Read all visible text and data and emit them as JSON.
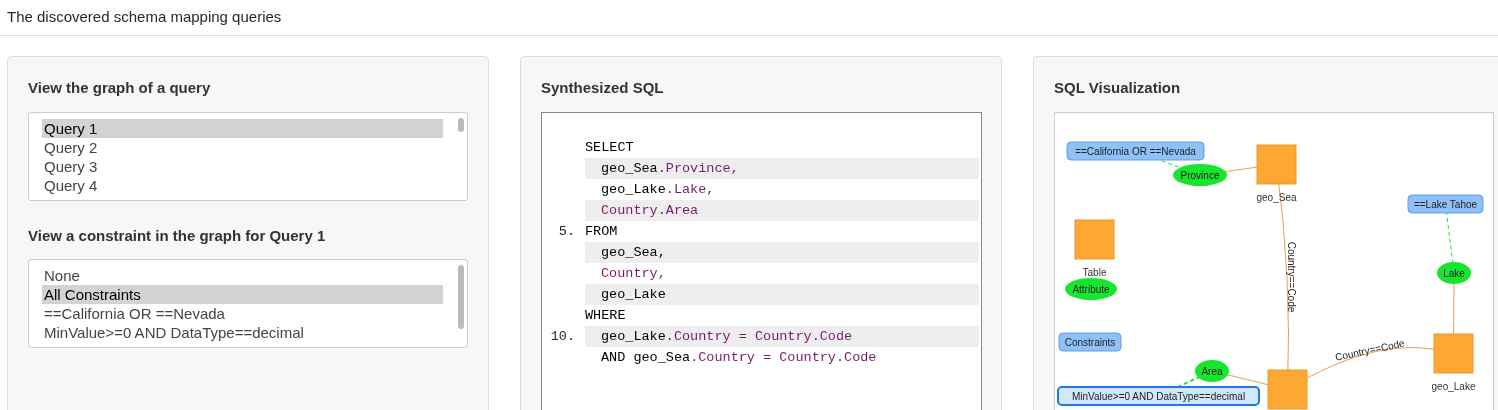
{
  "header": {
    "title": "The discovered schema mapping queries"
  },
  "query_panel": {
    "title": "View the graph of a query",
    "queries": [
      {
        "label": "Query 1",
        "selected": true
      },
      {
        "label": "Query 2",
        "selected": false
      },
      {
        "label": "Query 3",
        "selected": false
      },
      {
        "label": "Query 4",
        "selected": false
      }
    ],
    "constraint_title": "View a constraint in the graph for Query 1",
    "constraints": [
      {
        "label": "None",
        "selected": false
      },
      {
        "label": "All Constraints",
        "selected": true
      },
      {
        "label": "==California OR ==Nevada",
        "selected": false
      },
      {
        "label": "MinValue>=0 AND DataType==decimal",
        "selected": false
      }
    ]
  },
  "sql_panel": {
    "title": "Synthesized SQL",
    "clauses": [
      {
        "keyword": "SELECT",
        "lines": [
          [
            {
              "t": "geo_Sea",
              "kind": "table"
            },
            {
              "t": ".Province,",
              "kind": "member"
            }
          ],
          [
            {
              "t": "geo_Lake",
              "kind": "table"
            },
            {
              "t": ".Lake,",
              "kind": "member"
            }
          ],
          [
            {
              "t": "Country.Area",
              "kind": "member"
            }
          ]
        ]
      },
      {
        "keyword": "FROM",
        "number": "5.",
        "lines": [
          [
            {
              "t": "geo_Sea,",
              "kind": "table"
            }
          ],
          [
            {
              "t": "Country,",
              "kind": "member"
            }
          ],
          [
            {
              "t": "geo_Lake",
              "kind": "table"
            }
          ]
        ]
      },
      {
        "keyword": "WHERE",
        "lines": [
          [
            {
              "t": "geo_Lake",
              "kind": "table"
            },
            {
              "t": ".Country = Country.Code",
              "kind": "member"
            }
          ],
          [
            {
              "t": "AND geo_Sea",
              "kind": "table"
            },
            {
              "t": ".Country = Country.Code",
              "kind": "member"
            }
          ]
        ],
        "numbers": {
          "0": "10."
        }
      }
    ]
  },
  "viz_panel": {
    "title": "SQL Visualization",
    "nodes": [
      {
        "kind": "constraint",
        "label": "==California OR ==Nevada",
        "selected": false
      },
      {
        "kind": "attribute",
        "label": "Province"
      },
      {
        "kind": "table",
        "label": "geo_Sea"
      },
      {
        "kind": "table",
        "label": "Table"
      },
      {
        "kind": "attribute",
        "label": "Attribute"
      },
      {
        "kind": "constraint",
        "label": "Constraints",
        "selected": false
      },
      {
        "kind": "constraint",
        "label": "==Lake Tahoe",
        "selected": false
      },
      {
        "kind": "attribute",
        "label": "Lake"
      },
      {
        "kind": "table",
        "label": "geo_Lake"
      },
      {
        "kind": "attribute",
        "label": "Area"
      },
      {
        "kind": "constraint",
        "label": "MinValue>=0 AND DataType==decimal",
        "selected": true
      },
      {
        "kind": "table"
      }
    ],
    "edges": [
      {
        "kind": "attribute"
      },
      {
        "kind": "constraint",
        "selected": false
      },
      {
        "kind": "join",
        "label": "Country==Code"
      },
      {
        "kind": "join",
        "label": "Country==Code"
      },
      {
        "kind": "attribute"
      },
      {
        "kind": "constraint",
        "selected": false
      },
      {
        "kind": "attribute"
      },
      {
        "kind": "constraint",
        "selected": true
      }
    ]
  }
}
